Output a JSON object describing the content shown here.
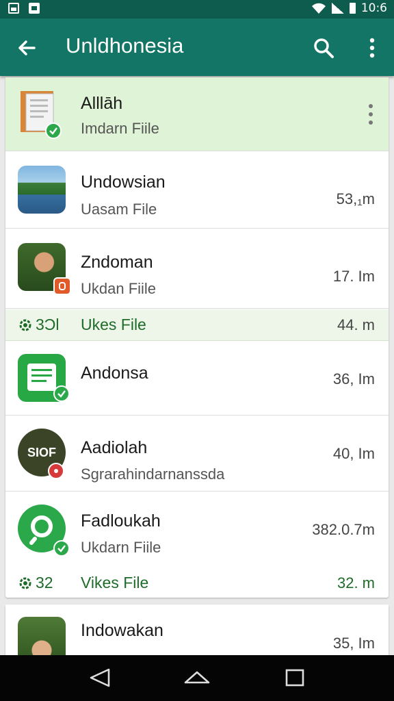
{
  "status_bar": {
    "time": "10:6"
  },
  "app_bar": {
    "title": "Unldhonesia"
  },
  "items": [
    {
      "title": "Alllāh",
      "subtitle": "Imdarn Fiile",
      "size": ""
    },
    {
      "title": "Undowsian",
      "subtitle": "Uasam File",
      "size": "53,₁m"
    },
    {
      "title": "Zndoman",
      "subtitle": "Ukdan Fiile",
      "size": "17. Im"
    },
    {
      "title": "Andonsa",
      "subtitle": "",
      "size": "36, Im"
    },
    {
      "title": "Aadiolah",
      "subtitle": "Sgrarahindarnanssda",
      "size": "40, Im"
    },
    {
      "title": "Fadloukah",
      "subtitle": "Ukdarn Fiile",
      "size": "382.0.7m"
    },
    {
      "title": "Indowakan",
      "subtitle": "",
      "size": "35, Im"
    }
  ],
  "groups": [
    {
      "count": "3Ɔl",
      "label": "Ukes File",
      "size": "44. m"
    },
    {
      "count": "32",
      "label": "Vikes File",
      "size": "32. m"
    }
  ],
  "thumb_texts": {
    "item5": "SIOF"
  },
  "colors": {
    "app_bar": "#137565",
    "status_bar": "#0d5c4d",
    "highlight": "#dff3d6",
    "accent_green": "#2aa84a"
  }
}
